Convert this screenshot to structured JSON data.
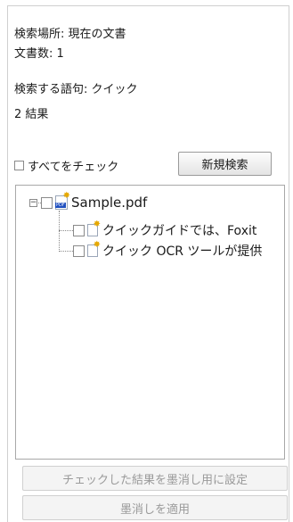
{
  "info": {
    "search_location_label": "検索場所:",
    "search_location_value": "現在の文書",
    "doc_count_label": "文書数:",
    "doc_count_value": "1",
    "search_term_label": "検索する語句:",
    "search_term_value": "クイック",
    "result_count": "2",
    "result_label": "結果"
  },
  "controls": {
    "check_all_label": "すべてをチェック",
    "new_search_label": "新規検索"
  },
  "tree": {
    "root": {
      "label": "Sample.pdf",
      "checked": false,
      "expanded": true
    },
    "children": [
      {
        "label": "クイックガイドでは、Foxit",
        "checked": false
      },
      {
        "label": "クイック OCR ツールが提供",
        "checked": false
      }
    ]
  },
  "footer": {
    "mark_checked_label": "チェックした結果を墨消し用に設定",
    "apply_redaction_label": "墨消しを適用"
  }
}
